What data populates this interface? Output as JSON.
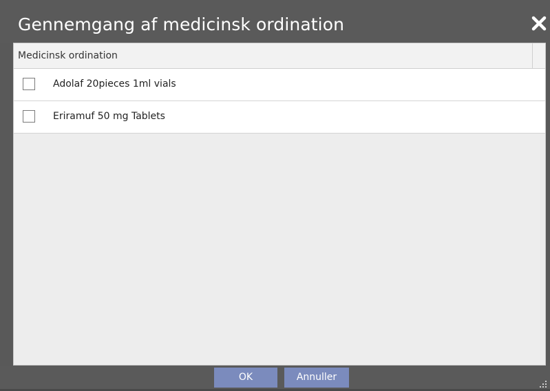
{
  "dialog": {
    "title": "Gennemgang af medicinsk ordination",
    "close_icon": "close-icon"
  },
  "list": {
    "column_header": "Medicinsk ordination",
    "items": [
      {
        "label": "Adolaf 20pieces 1ml vials",
        "checked": false
      },
      {
        "label": "Eriramuf 50  mg Tablets",
        "checked": false
      }
    ]
  },
  "footer": {
    "ok_label": "OK",
    "cancel_label": "Annuller",
    "resize_icon": "resize-grip-icon"
  },
  "colors": {
    "titlebar": "#5a5a5a",
    "button_accent": "#7b8bbd",
    "content_bg": "#ededed",
    "row_bg": "#ffffff"
  }
}
